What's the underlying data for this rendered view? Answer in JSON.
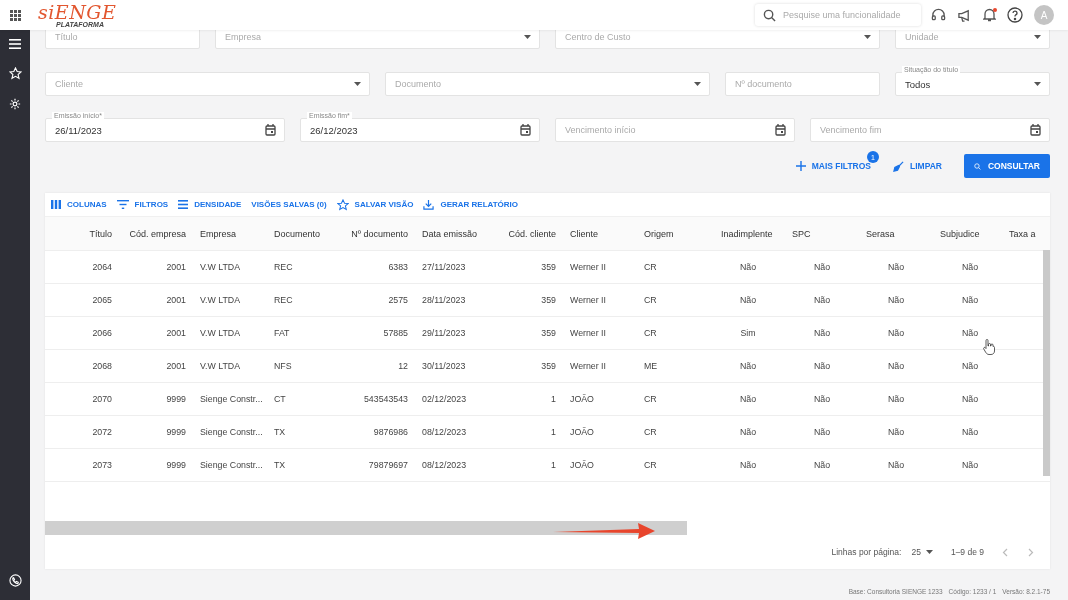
{
  "header": {
    "logo": "siENGE",
    "logo_subtitle": "PLATAFORMA",
    "search_placeholder": "Pesquise uma funcionalidade",
    "avatar": "A",
    "has_notification": true
  },
  "filters": [
    [
      {
        "kind": "text",
        "placeholder": "Título"
      },
      {
        "kind": "select",
        "placeholder": "Empresa"
      },
      {
        "kind": "select",
        "placeholder": "Centro de Custo"
      },
      {
        "kind": "select",
        "placeholder": "Unidade"
      }
    ],
    [
      {
        "kind": "select",
        "placeholder": "Cliente"
      },
      {
        "kind": "select",
        "placeholder": "Documento"
      },
      {
        "kind": "text",
        "placeholder": "Nº documento"
      },
      {
        "kind": "select",
        "label": "Situação do título",
        "value": "Todos"
      }
    ],
    [
      {
        "kind": "date",
        "label": "Emissão início*",
        "value": "26/11/2023"
      },
      {
        "kind": "date",
        "label": "Emissão fim*",
        "value": "26/12/2023"
      },
      {
        "kind": "date",
        "placeholder": "Vencimento início"
      },
      {
        "kind": "date",
        "placeholder": "Vencimento fim"
      }
    ]
  ],
  "actions": [
    {
      "kind": "add",
      "label": "MAIS FILTROS",
      "badge": "1"
    },
    {
      "kind": "clear",
      "label": "LIMPAR"
    },
    {
      "kind": "primary",
      "label": "CONSULTAR"
    }
  ],
  "toolbar": [
    {
      "kind": "columns",
      "label": "COLUNAS"
    },
    {
      "kind": "filter",
      "label": "FILTROS"
    },
    {
      "kind": "density",
      "label": "DENSIDADE"
    },
    {
      "kind": "plain",
      "label": "VISÕES SALVAS (0)"
    },
    {
      "kind": "star",
      "label": "SALVAR VISÃO"
    },
    {
      "kind": "download",
      "label": "GERAR RELATÓRIO"
    }
  ],
  "table": {
    "columns": [
      "Título",
      "Cód. empresa",
      "Empresa",
      "Documento",
      "Nº documento",
      "Data emissão",
      "Cód. cliente",
      "Cliente",
      "Origem",
      "Inadimplente",
      "SPC",
      "Serasa",
      "Subjudice",
      "Taxa a"
    ],
    "rows": [
      [
        "2064",
        "2001",
        "V.W LTDA",
        "REC",
        "6383",
        "27/11/2023",
        "359",
        "Werner II",
        "CR",
        "Não",
        "Não",
        "Não",
        "Não"
      ],
      [
        "2065",
        "2001",
        "V.W LTDA",
        "REC",
        "2575",
        "28/11/2023",
        "359",
        "Werner II",
        "CR",
        "Não",
        "Não",
        "Não",
        "Não"
      ],
      [
        "2066",
        "2001",
        "V.W LTDA",
        "FAT",
        "57885",
        "29/11/2023",
        "359",
        "Werner II",
        "CR",
        "Sim",
        "Não",
        "Não",
        "Não"
      ],
      [
        "2068",
        "2001",
        "V.W LTDA",
        "NFS",
        "12",
        "30/11/2023",
        "359",
        "Werner II",
        "ME",
        "Não",
        "Não",
        "Não",
        "Não"
      ],
      [
        "2070",
        "9999",
        "Sienge Constr...",
        "CT",
        "543543543",
        "02/12/2023",
        "1",
        "JOÃO",
        "CR",
        "Não",
        "Não",
        "Não",
        "Não"
      ],
      [
        "2072",
        "9999",
        "Sienge Constr...",
        "TX",
        "9876986",
        "08/12/2023",
        "1",
        "JOÃO",
        "CR",
        "Não",
        "Não",
        "Não",
        "Não"
      ],
      [
        "2073",
        "9999",
        "Sienge Constr...",
        "TX",
        "79879697",
        "08/12/2023",
        "1",
        "JOÃO",
        "CR",
        "Não",
        "Não",
        "Não",
        "Não"
      ]
    ]
  },
  "pagination": {
    "rows_per_page_label": "Linhas por página:",
    "rows_per_page": "25",
    "range": "1–9 de 9"
  },
  "status_bar": [
    "Base: Consultoria SIENGE 1233",
    "Código: 1233 / 1",
    "Versão: 8.2.1-75"
  ]
}
